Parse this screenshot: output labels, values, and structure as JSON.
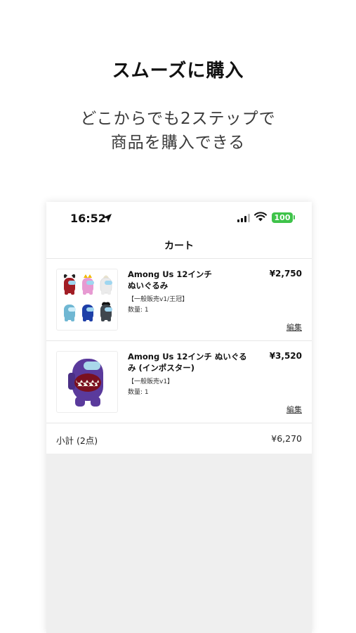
{
  "promo": {
    "headline": "スムーズに購入",
    "sub_line1": "どこからでも2ステップで",
    "sub_line2": "商品を購入できる"
  },
  "status_bar": {
    "time": "16:52",
    "battery": "100",
    "battery_color": "#3fc34a"
  },
  "nav": {
    "title": "カート"
  },
  "cart": {
    "items": [
      {
        "name_line1": "Among Us 12インチ",
        "name_line2": "ぬいぐるみ",
        "variant": "【一般販売v1/王冠】",
        "quantity": "数量: 1",
        "price": "¥2,750",
        "edit": "編集",
        "image": "among-us-plush-set"
      },
      {
        "name_line1": "Among Us 12インチ ぬいぐる",
        "name_line2": "み (インポスター)",
        "variant": "【一般販売v1】",
        "quantity": "数量: 1",
        "price": "¥3,520",
        "edit": "編集",
        "image": "among-us-impostor-plush"
      }
    ],
    "subtotal_label": "小計 (2点)",
    "subtotal_value": "¥6,270"
  }
}
